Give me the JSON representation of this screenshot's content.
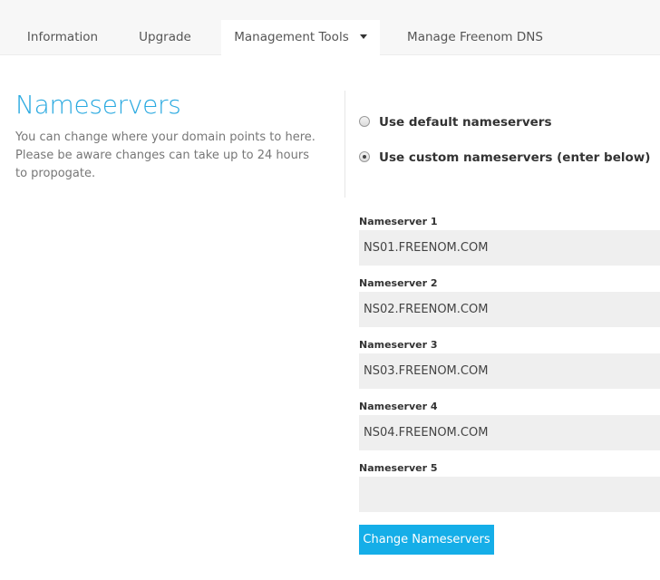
{
  "tabs": [
    {
      "label": "Information"
    },
    {
      "label": "Upgrade"
    },
    {
      "label": "Management Tools"
    },
    {
      "label": "Manage Freenom DNS"
    }
  ],
  "intro": {
    "title": "Nameservers",
    "description": "You can change where your domain points to here. Please be aware changes can take up to 24 hours to propogate."
  },
  "options": {
    "default_label": "Use default nameservers",
    "custom_label": "Use custom nameservers (enter below)",
    "selected": "custom"
  },
  "nameservers": [
    {
      "label": "Nameserver 1",
      "value": "NS01.FREENOM.COM"
    },
    {
      "label": "Nameserver 2",
      "value": "NS02.FREENOM.COM"
    },
    {
      "label": "Nameserver 3",
      "value": "NS03.FREENOM.COM"
    },
    {
      "label": "Nameserver 4",
      "value": "NS04.FREENOM.COM"
    },
    {
      "label": "Nameserver 5",
      "value": ""
    }
  ],
  "submit_label": "Change Nameservers",
  "colors": {
    "accent": "#29a9e0",
    "button": "#15aee8",
    "input_bg": "#efefef"
  }
}
